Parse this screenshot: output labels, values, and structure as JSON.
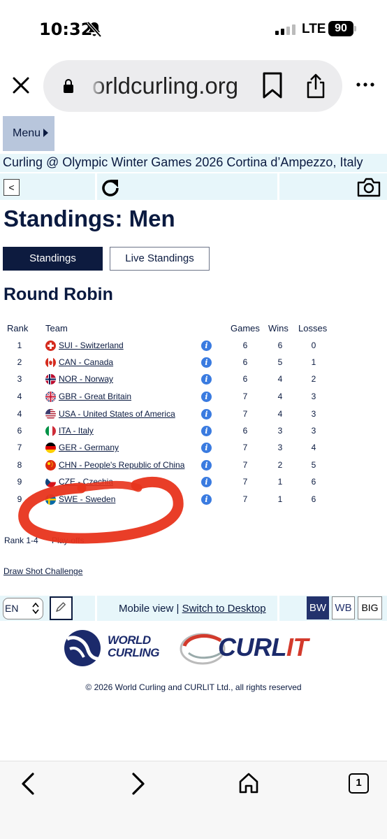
{
  "status_bar": {
    "time": "10:32",
    "network": "LTE",
    "battery": "90"
  },
  "browser": {
    "url": "orldcurling.org"
  },
  "site": {
    "menu_label": "Menu",
    "event_title": "Curling @ Olympic Winter Games 2026 Cortina d’Ampezzo, Italy",
    "back_label": "<",
    "page_title": "Standings: Men",
    "tabs": [
      {
        "label": "Standings",
        "active": true
      },
      {
        "label": "Live Standings",
        "active": false
      }
    ],
    "section_title": "Round Robin"
  },
  "standings_table": {
    "columns": [
      "Rank",
      "Team",
      "Games",
      "Wins",
      "Losses"
    ],
    "rows": [
      {
        "rank": "1",
        "team": "SUI - Switzerland",
        "games": "6",
        "wins": "6",
        "losses": "0",
        "flag": "switzerland"
      },
      {
        "rank": "2",
        "team": "CAN - Canada",
        "games": "6",
        "wins": "5",
        "losses": "1",
        "flag": "canada"
      },
      {
        "rank": "3",
        "team": "NOR - Norway",
        "games": "6",
        "wins": "4",
        "losses": "2",
        "flag": "norway"
      },
      {
        "rank": "4",
        "team": "GBR - Great Britain",
        "games": "7",
        "wins": "4",
        "losses": "3",
        "flag": "great-britain"
      },
      {
        "rank": "4",
        "team": "USA - United States of America",
        "games": "7",
        "wins": "4",
        "losses": "3",
        "flag": "usa"
      },
      {
        "rank": "6",
        "team": "ITA - Italy",
        "games": "6",
        "wins": "3",
        "losses": "3",
        "flag": "italy"
      },
      {
        "rank": "7",
        "team": "GER - Germany",
        "games": "7",
        "wins": "3",
        "losses": "4",
        "flag": "germany"
      },
      {
        "rank": "8",
        "team": "CHN - People's Republic of China",
        "games": "7",
        "wins": "2",
        "losses": "5",
        "flag": "china"
      },
      {
        "rank": "9",
        "team": "CZE - Czechia",
        "games": "7",
        "wins": "1",
        "losses": "6",
        "flag": "czechia"
      },
      {
        "rank": "9",
        "team": "SWE - Sweden",
        "games": "7",
        "wins": "1",
        "losses": "6",
        "flag": "sweden"
      }
    ],
    "info_icon": "i"
  },
  "legend": {
    "rank_range": "Rank 1-4",
    "meaning": "Play-offs"
  },
  "links": {
    "draw_shot": "Draw Shot Challenge"
  },
  "footer_bar": {
    "language": "EN",
    "mobile_view_text": "Mobile view | ",
    "switch_link": "Switch to Desktop",
    "bw": "BW",
    "wb": "WB",
    "big": "BIG"
  },
  "logos": {
    "world_curling_line1": "WORLD",
    "world_curling_line2": "CURLING",
    "curlit_part1": "CURL",
    "curlit_part2": "IT"
  },
  "copyright": "© 2026 World Curling and CURLIT Ltd., all rights reserved",
  "browser_bottom": {
    "tab_count": "1"
  },
  "colors": {
    "navy": "#0d1b3f",
    "light_cyan": "#e7f6fa",
    "menu_bg": "#b8c6dc",
    "info_blue": "#3a7be0",
    "annotation_red": "#e8341c",
    "curlit_red": "#d33a2c"
  }
}
